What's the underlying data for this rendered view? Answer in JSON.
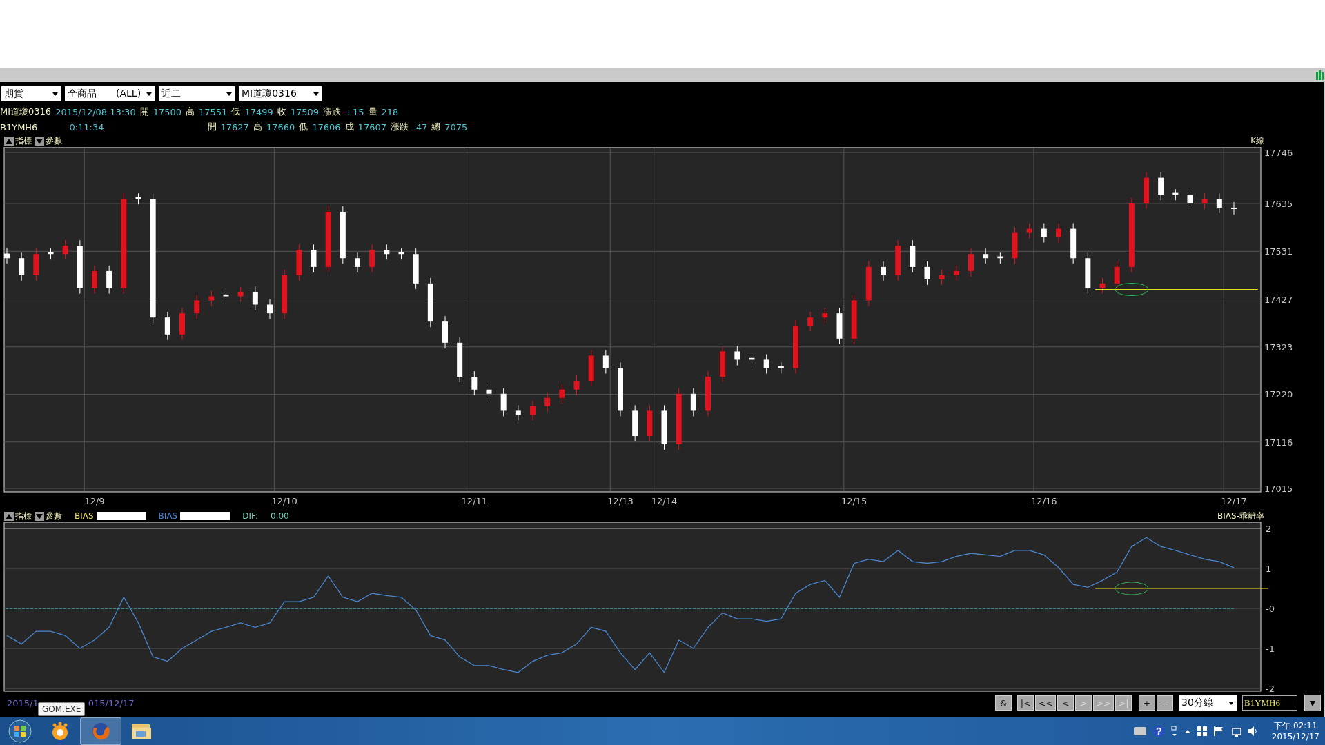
{
  "toolbar": {
    "dropdowns": [
      "期貨",
      "全商品　　(ALL)",
      "近二",
      "MI道瓊0316"
    ]
  },
  "quote_rows": [
    [
      {
        "kind": "label",
        "text": "MI道瓊0316"
      },
      {
        "kind": "value",
        "text": "2015/12/08 13:30"
      },
      {
        "kind": "label",
        "text": "開"
      },
      {
        "kind": "value",
        "text": "17500"
      },
      {
        "kind": "label",
        "text": "高"
      },
      {
        "kind": "value",
        "text": "17551"
      },
      {
        "kind": "label",
        "text": "低"
      },
      {
        "kind": "value",
        "text": "17499"
      },
      {
        "kind": "label",
        "text": "收"
      },
      {
        "kind": "value",
        "text": "17509"
      },
      {
        "kind": "label",
        "text": "漲跌"
      },
      {
        "kind": "value",
        "text": "+15"
      },
      {
        "kind": "label",
        "text": "量"
      },
      {
        "kind": "value",
        "text": "218"
      }
    ],
    [
      {
        "kind": "label",
        "text": "B1YMH6"
      },
      {
        "kind": "value",
        "text": "0:11:34"
      },
      {
        "kind": "label",
        "text": "開"
      },
      {
        "kind": "value",
        "text": "17627"
      },
      {
        "kind": "label",
        "text": "高"
      },
      {
        "kind": "value",
        "text": "17660"
      },
      {
        "kind": "label",
        "text": "低"
      },
      {
        "kind": "value",
        "text": "17606"
      },
      {
        "kind": "label",
        "text": "成"
      },
      {
        "kind": "value",
        "text": "17607"
      },
      {
        "kind": "label",
        "text": "漲跌"
      },
      {
        "kind": "value",
        "text": "-47"
      },
      {
        "kind": "label",
        "text": "總"
      },
      {
        "kind": "value",
        "text": "7075"
      }
    ]
  ],
  "price_panel": {
    "indicator_button": "指標",
    "params_button": "參數",
    "chart_data": {
      "type": "candlestick",
      "title": "K線",
      "grid": true,
      "ylim": [
        17015,
        17746
      ],
      "yticks": [
        17746,
        17635,
        17531,
        17427,
        17323,
        17220,
        17116,
        17015
      ],
      "categories": [
        null,
        null,
        null,
        null,
        null,
        null,
        "12/9",
        null,
        null,
        null,
        null,
        null,
        null,
        null,
        null,
        null,
        null,
        null,
        null,
        "12/10",
        null,
        null,
        null,
        null,
        null,
        null,
        null,
        null,
        null,
        null,
        null,
        null,
        "12/11",
        null,
        null,
        null,
        null,
        null,
        null,
        null,
        null,
        null,
        "12/13",
        null,
        null,
        "12/14",
        null,
        null,
        null,
        null,
        null,
        null,
        null,
        null,
        null,
        null,
        null,
        null,
        "12/15",
        null,
        null,
        null,
        null,
        null,
        null,
        null,
        null,
        null,
        null,
        null,
        null,
        "12/16",
        null,
        null,
        null,
        null,
        null,
        null,
        null,
        null,
        null,
        null,
        null,
        null,
        "12/17"
      ],
      "ohlc": [
        [
          17526,
          17538,
          17504,
          17516
        ],
        [
          17516,
          17528,
          17467,
          17479
        ],
        [
          17479,
          17537,
          17467,
          17525
        ],
        [
          17529,
          17537,
          17513,
          17525
        ],
        [
          17525,
          17555,
          17513,
          17543
        ],
        [
          17543,
          17555,
          17439,
          17451
        ],
        [
          17451,
          17500,
          17439,
          17488
        ],
        [
          17488,
          17500,
          17439,
          17451
        ],
        [
          17451,
          17657,
          17439,
          17645
        ],
        [
          17649,
          17657,
          17633,
          17645
        ],
        [
          17645,
          17657,
          17375,
          17387
        ],
        [
          17387,
          17399,
          17338,
          17350
        ],
        [
          17350,
          17408,
          17338,
          17396
        ],
        [
          17396,
          17436,
          17384,
          17424
        ],
        [
          17424,
          17445,
          17412,
          17433
        ],
        [
          17437,
          17445,
          17421,
          17433
        ],
        [
          17433,
          17454,
          17421,
          17442
        ],
        [
          17442,
          17454,
          17403,
          17415
        ],
        [
          17415,
          17427,
          17384,
          17396
        ],
        [
          17396,
          17491,
          17384,
          17479
        ],
        [
          17479,
          17546,
          17467,
          17534
        ],
        [
          17534,
          17546,
          17485,
          17497
        ],
        [
          17497,
          17629,
          17485,
          17617
        ],
        [
          17617,
          17629,
          17504,
          17516
        ],
        [
          17516,
          17528,
          17485,
          17497
        ],
        [
          17497,
          17546,
          17485,
          17534
        ],
        [
          17534,
          17546,
          17513,
          17525
        ],
        [
          17529,
          17537,
          17513,
          17525
        ],
        [
          17525,
          17537,
          17449,
          17461
        ],
        [
          17461,
          17473,
          17366,
          17378
        ],
        [
          17378,
          17390,
          17320,
          17332
        ],
        [
          17332,
          17344,
          17246,
          17258
        ],
        [
          17258,
          17270,
          17218,
          17230
        ],
        [
          17230,
          17242,
          17209,
          17221
        ],
        [
          17221,
          17233,
          17172,
          17184
        ],
        [
          17184,
          17196,
          17163,
          17175
        ],
        [
          17175,
          17206,
          17163,
          17194
        ],
        [
          17194,
          17224,
          17182,
          17212
        ],
        [
          17212,
          17242,
          17200,
          17230
        ],
        [
          17230,
          17261,
          17218,
          17249
        ],
        [
          17249,
          17316,
          17237,
          17304
        ],
        [
          17304,
          17316,
          17265,
          17277
        ],
        [
          17277,
          17289,
          17172,
          17184
        ],
        [
          17184,
          17196,
          17117,
          17129
        ],
        [
          17129,
          17196,
          17117,
          17184
        ],
        [
          17184,
          17196,
          17099,
          17111
        ],
        [
          17111,
          17233,
          17099,
          17221
        ],
        [
          17221,
          17233,
          17172,
          17184
        ],
        [
          17184,
          17270,
          17172,
          17258
        ],
        [
          17258,
          17325,
          17246,
          17313
        ],
        [
          17313,
          17325,
          17283,
          17295
        ],
        [
          17299,
          17307,
          17283,
          17295
        ],
        [
          17295,
          17307,
          17265,
          17277
        ],
        [
          17281,
          17289,
          17265,
          17277
        ],
        [
          17277,
          17381,
          17265,
          17369
        ],
        [
          17369,
          17399,
          17357,
          17387
        ],
        [
          17387,
          17408,
          17375,
          17396
        ],
        [
          17396,
          17408,
          17329,
          17341
        ],
        [
          17341,
          17436,
          17329,
          17424
        ],
        [
          17424,
          17509,
          17412,
          17497
        ],
        [
          17497,
          17509,
          17467,
          17479
        ],
        [
          17479,
          17555,
          17467,
          17543
        ],
        [
          17543,
          17555,
          17485,
          17497
        ],
        [
          17497,
          17509,
          17458,
          17470
        ],
        [
          17470,
          17491,
          17458,
          17479
        ],
        [
          17479,
          17500,
          17467,
          17488
        ],
        [
          17488,
          17537,
          17476,
          17525
        ],
        [
          17525,
          17537,
          17504,
          17516
        ],
        [
          17520,
          17528,
          17504,
          17516
        ],
        [
          17516,
          17583,
          17504,
          17571
        ],
        [
          17571,
          17592,
          17559,
          17580
        ],
        [
          17580,
          17592,
          17550,
          17562
        ],
        [
          17562,
          17592,
          17550,
          17580
        ],
        [
          17580,
          17592,
          17504,
          17516
        ],
        [
          17516,
          17528,
          17439,
          17451
        ],
        [
          17451,
          17473,
          17439,
          17461
        ],
        [
          17461,
          17509,
          17449,
          17497
        ],
        [
          17497,
          17647,
          17485,
          17635
        ],
        [
          17635,
          17703,
          17623,
          17691
        ],
        [
          17691,
          17703,
          17642,
          17654
        ],
        [
          17658,
          17666,
          17642,
          17654
        ],
        [
          17654,
          17666,
          17623,
          17635
        ],
        [
          17635,
          17657,
          17623,
          17645
        ],
        [
          17645,
          17657,
          17614,
          17626
        ],
        [
          17626,
          17638,
          17611,
          17623
        ]
      ],
      "ref_lines": [
        {
          "axis": "y",
          "value": 17448,
          "color": "#e8e020"
        }
      ]
    }
  },
  "bias_panel": {
    "indicator_button": "指標",
    "params_button": "參數",
    "legend": [
      {
        "label": "BIAS",
        "color": "#e8e060"
      }
    ],
    "dif_label": "DIF:",
    "dif_value": "0.00",
    "chart_data": {
      "type": "line",
      "title": "BIAS-乖離率",
      "grid": true,
      "ylim": [
        -2,
        2
      ],
      "yticks": [
        {
          "value": 2,
          "label": "2"
        },
        {
          "value": 1,
          "label": "1"
        },
        {
          "value": 0,
          "label": "-0"
        },
        {
          "value": -1,
          "label": "-1"
        },
        {
          "value": -2,
          "label": "-2"
        }
      ],
      "series": [
        {
          "name": "BIAS",
          "color": "#4a86d0",
          "values": [
            -0.68,
            -0.89,
            -0.57,
            -0.57,
            -0.68,
            -1.0,
            -0.79,
            -0.47,
            0.28,
            -0.36,
            -1.21,
            -1.32,
            -1.0,
            -0.79,
            -0.57,
            -0.47,
            -0.36,
            -0.47,
            -0.36,
            0.17,
            0.17,
            0.28,
            0.81,
            0.28,
            0.17,
            0.38,
            0.32,
            0.28,
            -0.04,
            -0.68,
            -0.79,
            -1.21,
            -1.43,
            -1.43,
            -1.53,
            -1.6,
            -1.32,
            -1.17,
            -1.11,
            -0.89,
            -0.47,
            -0.57,
            -1.11,
            -1.53,
            -1.11,
            -1.6,
            -0.79,
            -1.0,
            -0.47,
            -0.11,
            -0.26,
            -0.26,
            -0.32,
            -0.26,
            0.38,
            0.6,
            0.7,
            0.28,
            1.13,
            1.23,
            1.17,
            1.45,
            1.17,
            1.13,
            1.17,
            1.3,
            1.38,
            1.34,
            1.3,
            1.45,
            1.45,
            1.34,
            1.02,
            0.6,
            0.53,
            0.7,
            0.91,
            1.55,
            1.77,
            1.55,
            1.45,
            1.34,
            1.23,
            1.17,
            1.02
          ]
        }
      ],
      "ref_lines": [
        {
          "axis": "y",
          "value": 0.5,
          "color": "#e8e020"
        },
        {
          "axis": "y",
          "value": 0,
          "color": "#40c0c0"
        }
      ]
    }
  },
  "bottom_bar": {
    "date_start": "2015/1",
    "date_end": "015/12/17",
    "nav_buttons": [
      {
        "label": "&",
        "disabled": false
      },
      {
        "label": "|<",
        "disabled": false
      },
      {
        "label": "<<",
        "disabled": false
      },
      {
        "label": "<",
        "disabled": false
      },
      {
        "label": ">",
        "disabled": true
      },
      {
        "label": ">>",
        "disabled": true
      },
      {
        "label": ">|",
        "disabled": true
      }
    ],
    "zoom_buttons": [
      "+",
      "-"
    ],
    "period_select": "30分線",
    "symbol_input": "B1YMH6",
    "menu_button": "▼"
  },
  "tooltip": "GOM.EXE",
  "taskbar": {
    "time": "下午 02:11",
    "date": "2015/12/17"
  }
}
